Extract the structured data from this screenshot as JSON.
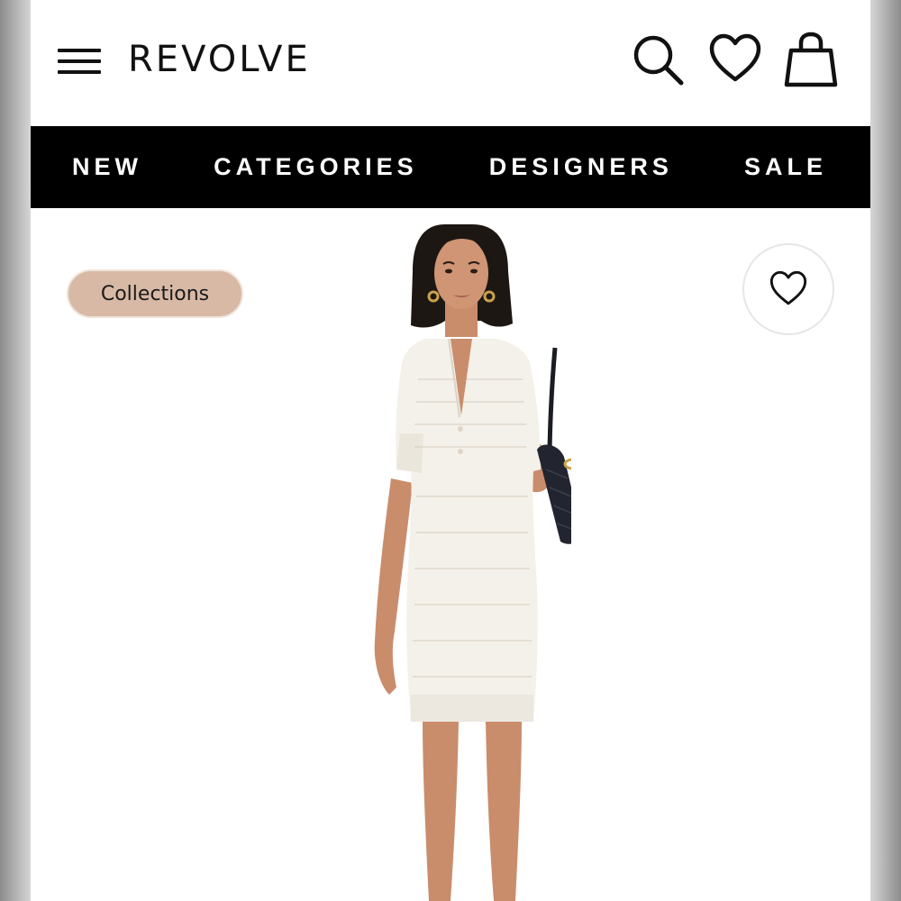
{
  "header": {
    "brand": "REVOLVE",
    "icons": {
      "menu": "hamburger-menu-icon",
      "search": "search-icon",
      "wishlist": "heart-icon",
      "cart": "shopping-bag-icon"
    }
  },
  "nav": {
    "items": [
      "NEW",
      "CATEGORIES",
      "DESIGNERS",
      "SALE"
    ]
  },
  "product": {
    "chip_label": "Collections",
    "favorite_icon": "heart-outline-icon",
    "image_alt": "Model wearing white crochet knit mini dress"
  },
  "colors": {
    "navbar_bg": "#000000",
    "chip_bg": "#d7b9a5",
    "dress": "#f4f1ea"
  }
}
